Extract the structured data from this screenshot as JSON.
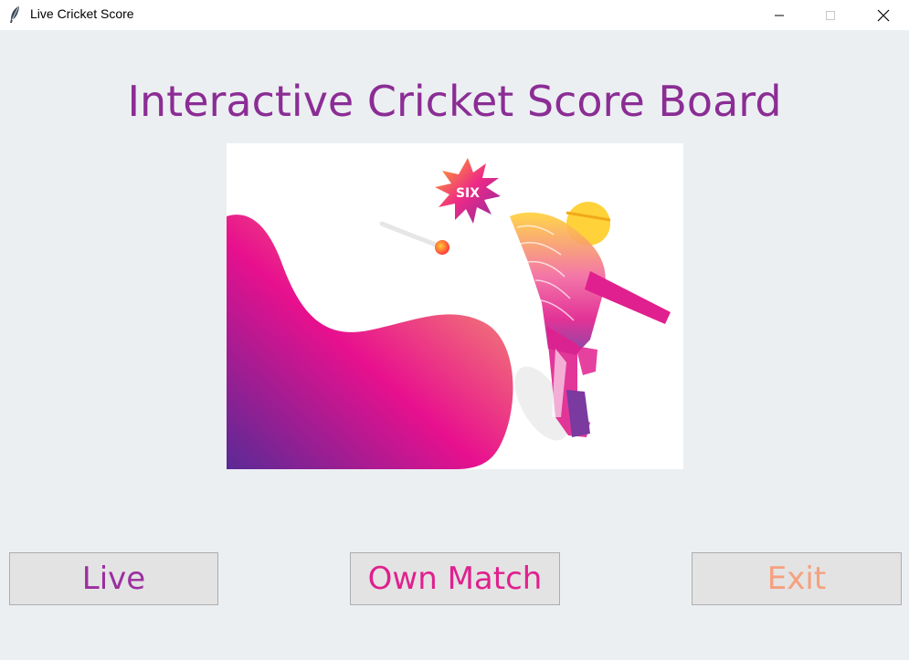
{
  "window": {
    "title": "Live Cricket Score",
    "app_icon": "feather-icon",
    "controls": [
      "minimize-icon",
      "maximize-icon",
      "close-icon"
    ]
  },
  "main": {
    "title": "Interactive Cricket Score Board",
    "hero_badge": "SIX"
  },
  "buttons": {
    "live": "Live",
    "own_match": "Own Match",
    "exit": "Exit"
  },
  "colors": {
    "title": "#8b2d95",
    "live_text": "#9b2fa0",
    "own_match_text": "#e0208e",
    "exit_text": "#f6a07e",
    "background": "#eceff2"
  }
}
